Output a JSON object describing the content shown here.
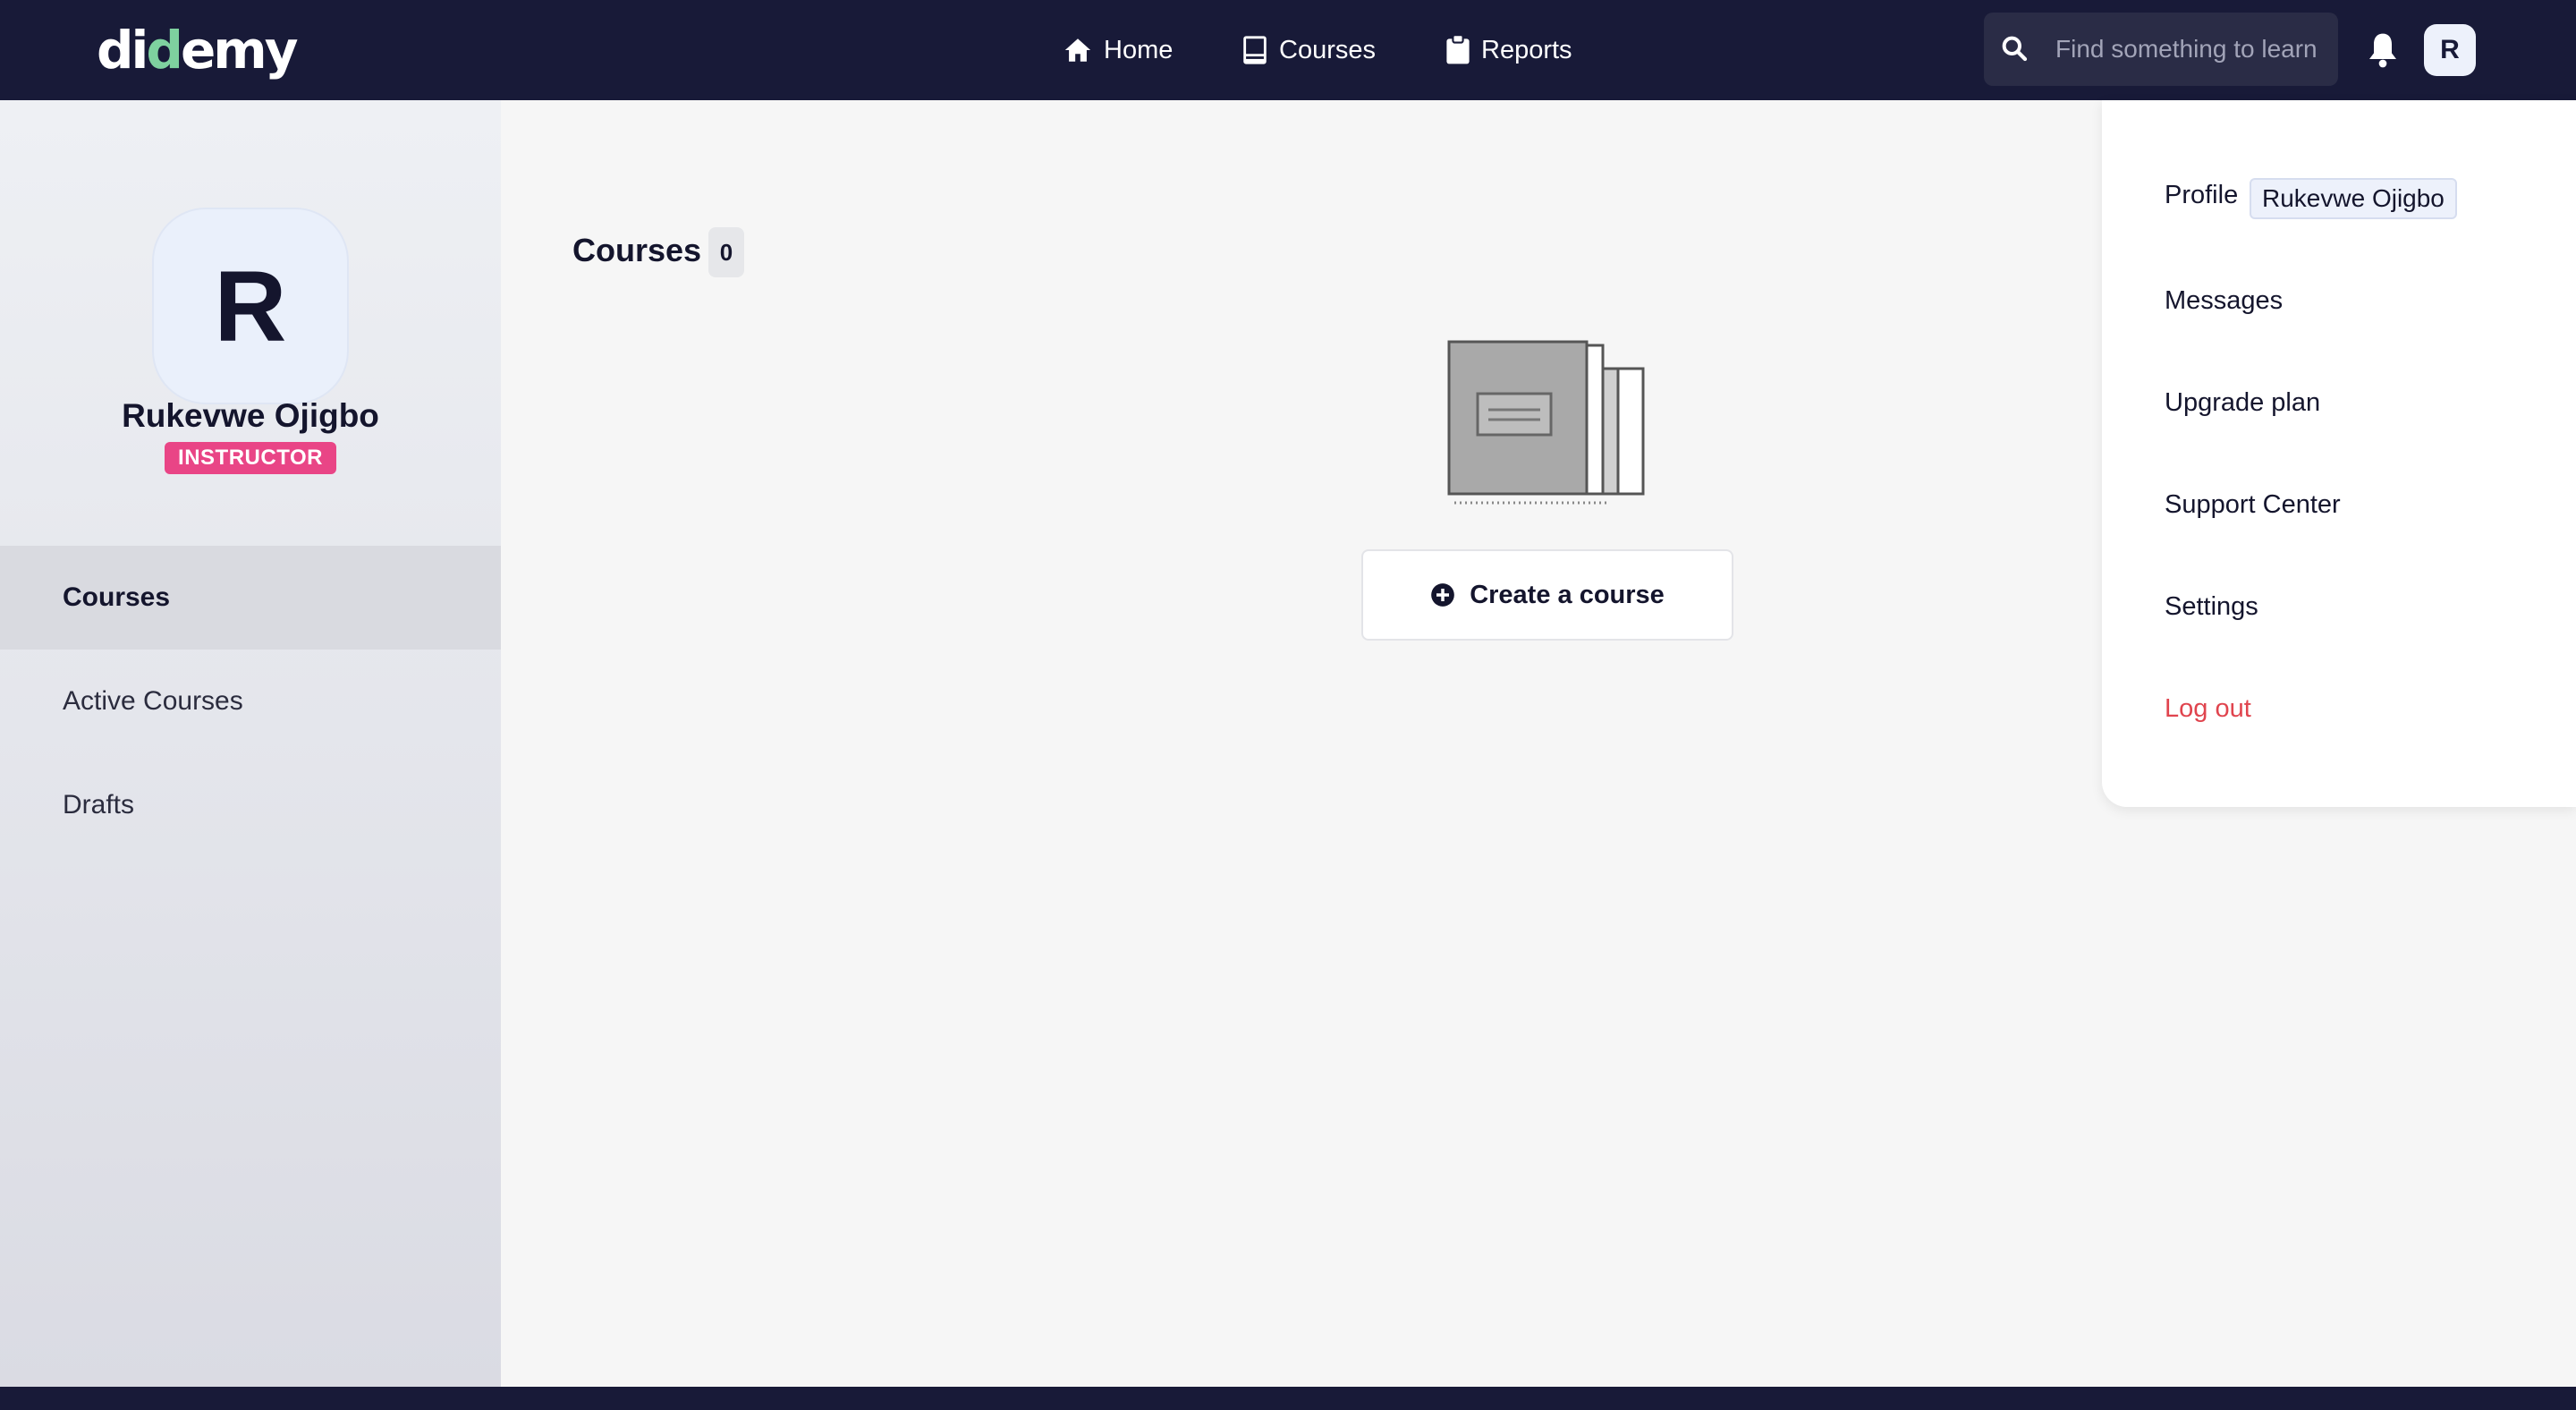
{
  "header": {
    "logo_pre": "di",
    "logo_accent": "d",
    "logo_post": "emy",
    "nav": [
      {
        "label": "Home",
        "icon": "home-icon"
      },
      {
        "label": "Courses",
        "icon": "book-icon"
      },
      {
        "label": "Reports",
        "icon": "clipboard-icon"
      }
    ],
    "search_placeholder": "Find something to learn",
    "avatar_initial": "R"
  },
  "sidebar": {
    "avatar_initial": "R",
    "name": "Rukevwe Ojigbo",
    "role": "INSTRUCTOR",
    "items": [
      {
        "label": "Courses",
        "active": true
      },
      {
        "label": "Active Courses",
        "active": false
      },
      {
        "label": "Drafts",
        "active": false
      }
    ]
  },
  "main": {
    "title": "Courses",
    "count": "0",
    "create_label": "Create a course"
  },
  "dropdown": {
    "profile_label": "Profile",
    "profile_name": "Rukevwe Ojigbo",
    "items": [
      "Messages",
      "Upgrade plan",
      "Support Center",
      "Settings"
    ],
    "logout_label": "Log out"
  },
  "colors": {
    "topbar": "#181a38",
    "accent_green": "#7ed19f",
    "role_badge": "#e94586",
    "logout": "#e0444e"
  }
}
